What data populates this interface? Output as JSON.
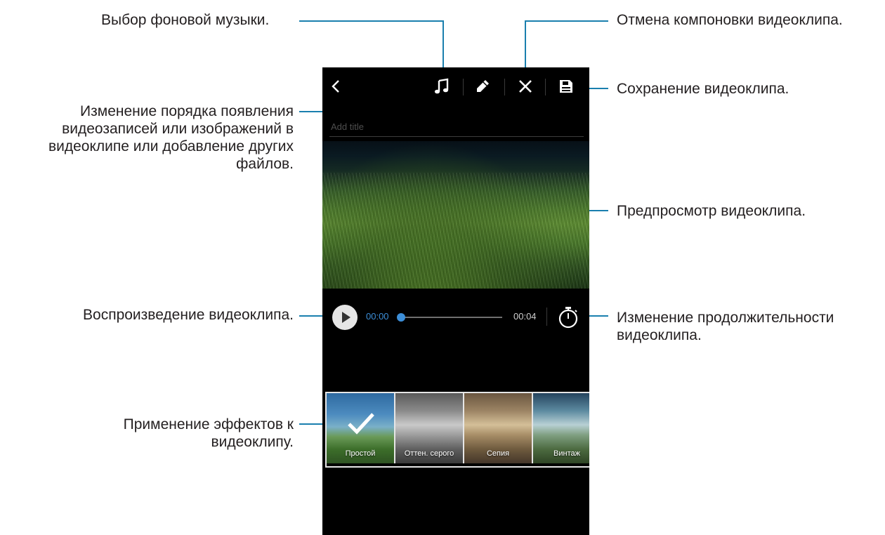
{
  "callouts": {
    "music": "Выбор фоновой музыки.",
    "cancel": "Отмена компоновки видеоклипа.",
    "save": "Сохранение видеоклипа.",
    "reorder": [
      "Изменение порядка появления",
      "видеозаписей или изображений в",
      "видеоклипе или добавление других",
      "файлов."
    ],
    "preview": "Предпросмотр видеоклипа.",
    "play": "Воспроизведение видеоклипа.",
    "duration": [
      "Изменение продолжительности",
      "видеоклипа."
    ],
    "effects": [
      "Применение эффектов к",
      "видеоклипу."
    ]
  },
  "toolbar": {
    "icons": [
      "back-icon",
      "music-note-icon",
      "pencil-icon",
      "close-icon",
      "save-disk-icon"
    ]
  },
  "title_input": {
    "placeholder": "Add title",
    "value": ""
  },
  "player": {
    "current_time": "00:00",
    "total_time": "00:04",
    "progress": 0.0
  },
  "effects": [
    {
      "label": "Простой",
      "selected": true
    },
    {
      "label": "Оттен. серого",
      "selected": false
    },
    {
      "label": "Сепия",
      "selected": false
    },
    {
      "label": "Винтаж",
      "selected": false
    }
  ],
  "colors": {
    "accent": "#3c8ed8",
    "callout_line": "#1a7fae",
    "screen_bg": "#000000"
  }
}
